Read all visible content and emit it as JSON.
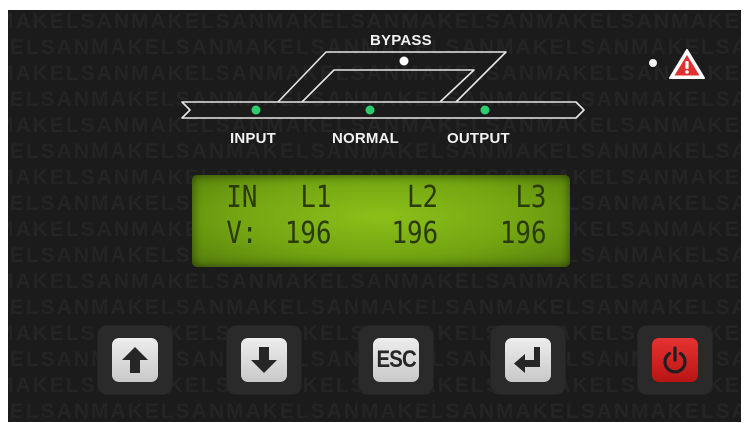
{
  "watermark": {
    "text": "MAKELSAN"
  },
  "flow_diagram": {
    "bypass_label": "BYPASS",
    "input_label": "INPUT",
    "normal_label": "NORMAL",
    "output_label": "OUTPUT",
    "led_colors": {
      "bypass": "#ffffff",
      "input": "#2ecc71",
      "normal": "#2ecc71",
      "output": "#2ecc71"
    }
  },
  "alarm": {
    "indicator_color": "#ffffff",
    "icon": "warning-triangle-icon",
    "icon_color": "#e03030"
  },
  "lcd": {
    "background_color": "#7fb316",
    "row1": {
      "label": "IN",
      "col1": "L1",
      "col2": "L2",
      "col3": "L3"
    },
    "row2": {
      "label": "V:",
      "col1": "196",
      "col2": "196",
      "col3": "196"
    }
  },
  "buttons": {
    "up": {
      "icon": "arrow-up-icon"
    },
    "down": {
      "icon": "arrow-down-icon"
    },
    "esc": {
      "label": "ESC"
    },
    "enter": {
      "icon": "enter-return-icon"
    },
    "power": {
      "icon": "power-icon",
      "color": "#d42222"
    }
  }
}
